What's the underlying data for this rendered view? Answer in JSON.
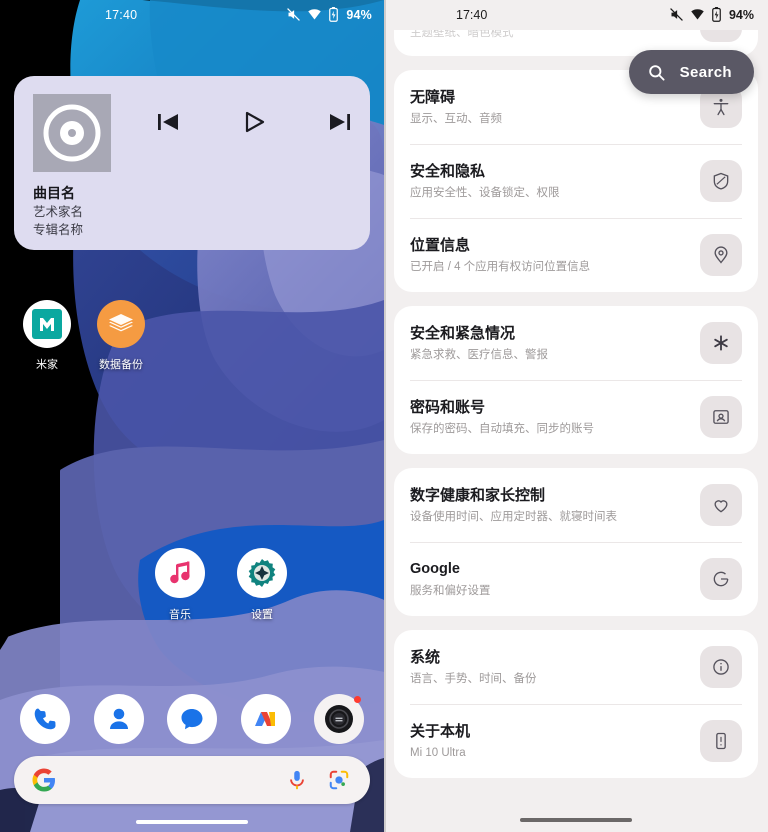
{
  "home": {
    "status_bar": {
      "clock": "17:40",
      "battery_percent": "94%",
      "icons": [
        "sound-off-icon",
        "wifi-icon",
        "battery-charging-icon"
      ]
    },
    "music_widget": {
      "track_title": "曲目名",
      "artist": "艺术家名",
      "album": "专辑名称",
      "controls": [
        "previous-track",
        "play",
        "next-track"
      ],
      "bg_color": "#dedcf0"
    },
    "apps_row1": [
      {
        "label": "米家",
        "icon": "mi-home-icon",
        "color": "#0aa8a0"
      },
      {
        "label": "数据备份",
        "icon": "data-backup-layers-icon",
        "color": "#f59b42"
      }
    ],
    "apps_row2": [
      {
        "label": "音乐",
        "icon": "music-note-icon",
        "color": "#e8336e"
      },
      {
        "label": "设置",
        "icon": "settings-gear-icon",
        "color": "#10837f"
      }
    ],
    "dock": [
      {
        "name": "phone-icon",
        "color": "#1a73e8"
      },
      {
        "name": "contacts-icon",
        "color": "#1a73e8"
      },
      {
        "name": "messages-icon",
        "color": "#1a73e8"
      },
      {
        "name": "analytics-m-icon",
        "color": "#f9ab00"
      },
      {
        "name": "camera-icon",
        "color": "#202124",
        "badge": true
      }
    ],
    "search_bar": {
      "logo": "google-g-icon",
      "placeholder": "",
      "mic": "microphone-icon",
      "lens": "google-lens-icon"
    }
  },
  "settings": {
    "status_bar": {
      "clock": "17:40",
      "battery_percent": "94%"
    },
    "search_fab": {
      "label": "Search",
      "icon": "search-icon",
      "color": "#5a5865"
    },
    "partial_top_row": {
      "subtitle": "主题壁纸、暗色模式"
    },
    "groups": [
      {
        "items": [
          {
            "title": "无障碍",
            "subtitle": "显示、互动、音频",
            "icon": "accessibility-icon"
          },
          {
            "title": "安全和隐私",
            "subtitle": "应用安全性、设备锁定、权限",
            "icon": "shield-icon"
          },
          {
            "title": "位置信息",
            "subtitle": "已开启 / 4 个应用有权访问位置信息",
            "icon": "location-pin-icon"
          }
        ]
      },
      {
        "items": [
          {
            "title": "安全和紧急情况",
            "subtitle": "紧急求救、医疗信息、警报",
            "icon": "emergency-asterisk-icon"
          },
          {
            "title": "密码和账号",
            "subtitle": "保存的密码、自动填充、同步的账号",
            "icon": "id-card-icon"
          }
        ]
      },
      {
        "items": [
          {
            "title": "数字健康和家长控制",
            "subtitle": "设备使用时间、应用定时器、就寝时间表",
            "icon": "heart-shield-icon"
          },
          {
            "title": "Google",
            "subtitle": "服务和偏好设置",
            "icon": "google-g-outline-icon",
            "latin": true
          }
        ]
      },
      {
        "items": [
          {
            "title": "系统",
            "subtitle": "语言、手势、时间、备份",
            "icon": "info-circle-icon"
          },
          {
            "title": "关于本机",
            "subtitle": "Mi 10 Ultra",
            "icon": "phone-device-icon"
          }
        ]
      }
    ]
  }
}
